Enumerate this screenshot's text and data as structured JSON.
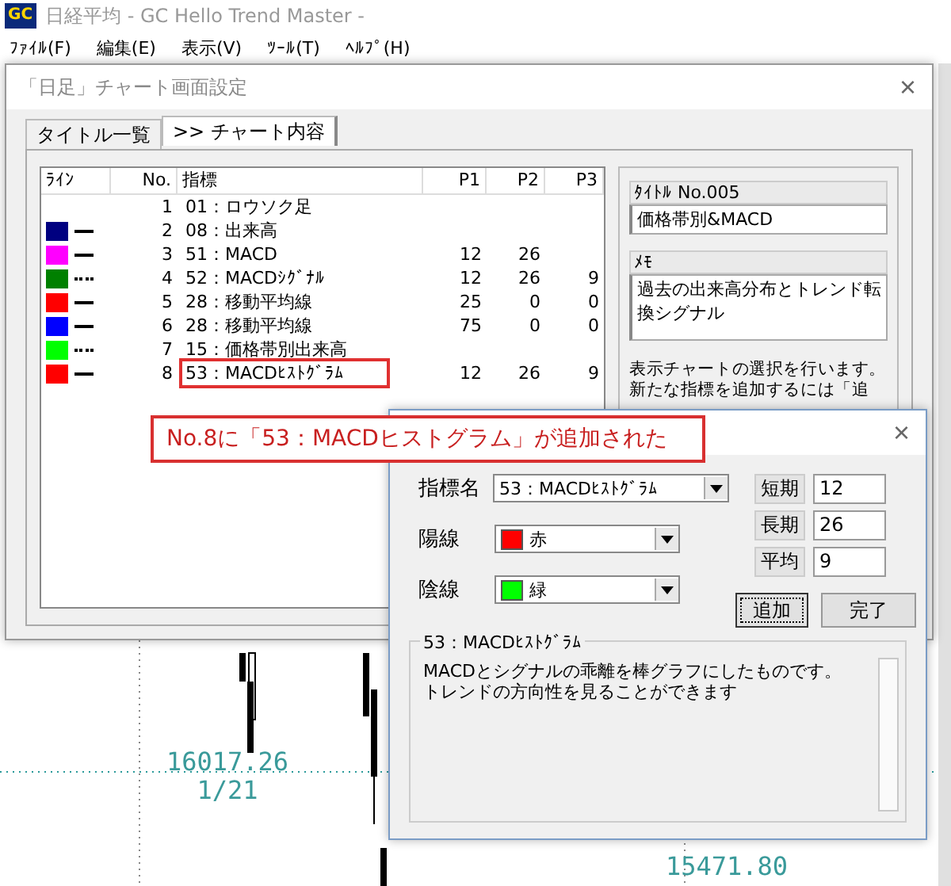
{
  "window": {
    "title": "日経平均 - GC Hello Trend Master -",
    "logo": "GC"
  },
  "menu": [
    "ﾌｧｲﾙ(F)",
    "編集(E)",
    "表示(V)",
    "ﾂｰﾙ(T)",
    "ﾍﾙﾌﾟ(H)"
  ],
  "chart": {
    "labels": [
      {
        "value": "16017.26",
        "date": "1/21"
      },
      {
        "value": "15471.80"
      }
    ]
  },
  "settings": {
    "title": "「日足」チャート画面設定",
    "close": "×",
    "tabs": [
      {
        "label": "タイトル一覧",
        "selected": false
      },
      {
        "label": ">> チャート内容",
        "selected": true
      }
    ],
    "table": {
      "columns": [
        "ﾗｲﾝ",
        "No.",
        "指標",
        "P1",
        "P2",
        "P3"
      ],
      "rows": [
        {
          "kind": "none",
          "no": "1",
          "indicator": "01：ロウソク足",
          "p1": "",
          "p2": "",
          "p3": "",
          "highlighted": false
        },
        {
          "color": "#000080",
          "kind": "solid",
          "no": "2",
          "indicator": "08：出来高",
          "p1": "",
          "p2": "",
          "p3": "",
          "highlighted": false
        },
        {
          "color": "#ff00ff",
          "kind": "solid",
          "no": "3",
          "indicator": "51：MACD",
          "p1": "12",
          "p2": "26",
          "p3": "",
          "highlighted": false
        },
        {
          "color": "#008000",
          "kind": "dotted",
          "no": "4",
          "indicator": "52：MACDｼｸﾞﾅﾙ",
          "p1": "12",
          "p2": "26",
          "p3": "9",
          "highlighted": false
        },
        {
          "color": "#ff0000",
          "kind": "solid",
          "no": "5",
          "indicator": "28：移動平均線",
          "p1": "25",
          "p2": "0",
          "p3": "0",
          "highlighted": false
        },
        {
          "color": "#0000ff",
          "kind": "solid",
          "no": "6",
          "indicator": "28：移動平均線",
          "p1": "75",
          "p2": "0",
          "p3": "0",
          "highlighted": false
        },
        {
          "color": "#00ff00",
          "kind": "dotted",
          "no": "7",
          "indicator": "15：価格帯別出来高",
          "p1": "",
          "p2": "",
          "p3": "",
          "highlighted": false
        },
        {
          "color": "#ff0000",
          "kind": "solid",
          "no": "8",
          "indicator": "53：MACDﾋｽﾄｸﾞﾗﾑ",
          "p1": "12",
          "p2": "26",
          "p3": "9",
          "highlighted": true
        }
      ]
    },
    "title_label": "ﾀｲﾄﾙ No.005",
    "title_value": "価格帯別&MACD",
    "memo_label": "ﾒﾓ",
    "memo_value": "過去の出来高分布とトレンド転換シグナル",
    "help": "表示チャートの選択を行います。新たな指標を追加するには「追"
  },
  "callout": "No.8に「53：MACDヒストグラム」が追加された",
  "dialog": {
    "close": "×",
    "indicator_label": "指標名",
    "indicator": "53：MACDﾋｽﾄｸﾞﾗﾑ",
    "candle_colors": [
      {
        "label": "陽線",
        "color": "#ff0000",
        "value": "赤"
      },
      {
        "label": "陰線",
        "color": "#00ff00",
        "value": "緑"
      }
    ],
    "params": [
      {
        "label": "短期",
        "value": "12"
      },
      {
        "label": "長期",
        "value": "26"
      },
      {
        "label": "平均",
        "value": "9"
      }
    ],
    "buttons": [
      {
        "label": "追加",
        "focused": true
      },
      {
        "label": "完了",
        "focused": false
      }
    ],
    "group_title": "53：MACDﾋｽﾄｸﾞﾗﾑ",
    "description": "MACDとシグナルの乖離を棒グラフにしたものです。トレンドの方向性を見ることができます"
  }
}
